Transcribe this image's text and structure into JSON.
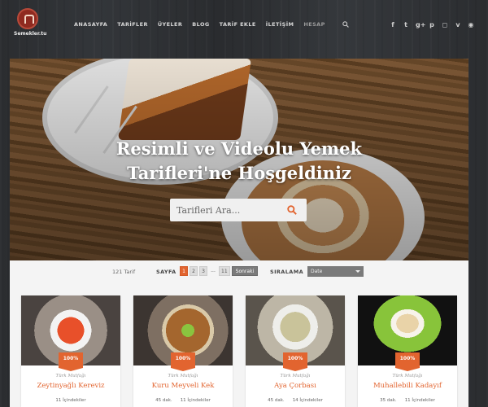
{
  "brand": {
    "logo_text": "Semekler.tu"
  },
  "nav": [
    {
      "label": "ANASAYFA"
    },
    {
      "label": "TARİFLER"
    },
    {
      "label": "ÜYELER"
    },
    {
      "label": "BLOG"
    },
    {
      "label": "TARİF EKLE"
    },
    {
      "label": "İLETİŞİM"
    },
    {
      "label": "HESAP"
    }
  ],
  "icons": {
    "search": "search-icon",
    "socials": [
      "facebook-icon",
      "twitter-icon",
      "google-plus-icon",
      "pinterest-icon",
      "instagram-icon",
      "vimeo-icon",
      "rss-icon"
    ]
  },
  "social_glyphs": [
    "f",
    "t",
    "g+",
    "p",
    "◻",
    "v",
    "◉"
  ],
  "hero": {
    "title_line1": "Resimli ve Videolu Yemek",
    "title_line2": "Tarifleri'ne Hoşgeldiniz",
    "search_placeholder": "Tarifleri Ara..."
  },
  "filters": {
    "count": "121 Tarif",
    "page_label": "SAYFA",
    "pages": [
      "1",
      "2",
      "3",
      "...",
      "11"
    ],
    "next_label": "Sonraki",
    "sort_label": "SIRALAMA",
    "sort_value": "Date"
  },
  "colors": {
    "accent": "#e2642f"
  },
  "cards": [
    {
      "badge": "100%",
      "category": "Türk Mutfağı",
      "title": "Zeytinyağlı Kereviz",
      "time": "",
      "ingredients": "11 İçindekiler"
    },
    {
      "badge": "100%",
      "category": "Türk Mutfağı",
      "title": "Kuru Meyveli Kek",
      "time": "45 dak.",
      "ingredients": "11 İçindekiler"
    },
    {
      "badge": "100%",
      "category": "Türk Mutfağı",
      "title": "Aya Çorbası",
      "time": "45 dak.",
      "ingredients": "14 İçindekiler"
    },
    {
      "badge": "100%",
      "category": "Türk Mutfağı",
      "title": "Muhallebili Kadayıf",
      "time": "35 dak.",
      "ingredients": "11 İçindekiler"
    }
  ]
}
